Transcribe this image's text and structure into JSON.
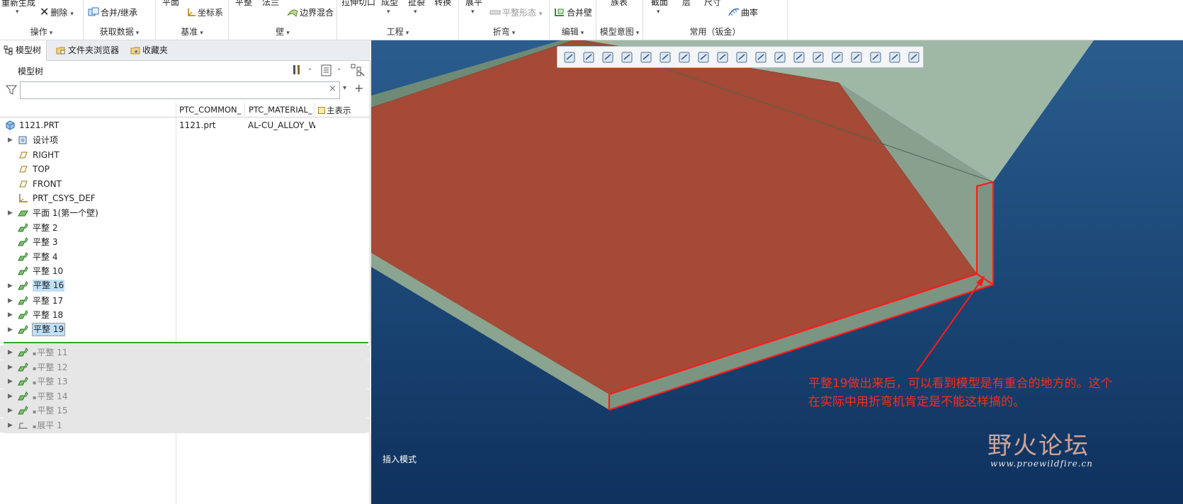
{
  "ribbon": {
    "top_row": {
      "regenerate": "重新生成",
      "delete": "删除",
      "merge_inherit": "合并/继承",
      "coord_sys": "坐标系",
      "plane": "平面",
      "flat": "平整",
      "flange": "法兰",
      "boundary_blend": "边界混合",
      "extrude_cut": "拉伸切口",
      "form": "成型",
      "rip": "扯裂",
      "convert": "转换",
      "unbend": "展平",
      "flat_state": "平整形态",
      "merge_wall": "合并壁",
      "family_table": "族表",
      "section": "截面",
      "layer": "层",
      "dimension": "尺寸",
      "curvature": "曲率"
    },
    "groups": {
      "operations": "操作",
      "get_data": "获取数据",
      "datum": "基准",
      "walls": "壁",
      "engineering": "工程",
      "bends": "折弯",
      "editing": "编辑",
      "model_intent": "模型意图",
      "common_sheetmetal": "常用（钣金）"
    }
  },
  "tabs": {
    "model_tree": "模型树",
    "folder_browser": "文件夹浏览器",
    "favorites": "收藏夹"
  },
  "tree": {
    "header": "模型树",
    "filter_placeholder": "",
    "columns": {
      "col1": "PTC_COMMON_",
      "col2": "PTC_MATERIAL_",
      "col3": "主表示"
    },
    "root": {
      "label": "1121.PRT",
      "c1": "1121.prt",
      "c2": "AL-CU_ALLOY_WR"
    },
    "items": [
      {
        "label": "设计项",
        "expandable": true,
        "icon": "design-items-icon"
      },
      {
        "label": "RIGHT",
        "expandable": false,
        "icon": "datum-plane-icon"
      },
      {
        "label": "TOP",
        "expandable": false,
        "icon": "datum-plane-icon"
      },
      {
        "label": "FRONT",
        "expandable": false,
        "icon": "datum-plane-icon"
      },
      {
        "label": "PRT_CSYS_DEF",
        "expandable": false,
        "icon": "csys-icon"
      },
      {
        "label": "平面 1(第一个壁)",
        "expandable": true,
        "icon": "first-wall-icon"
      },
      {
        "label": "平整 2",
        "expandable": false,
        "icon": "flat-wall-icon"
      },
      {
        "label": "平整 3",
        "expandable": false,
        "icon": "flat-wall-icon"
      },
      {
        "label": "平整 4",
        "expandable": false,
        "icon": "flat-wall-icon"
      },
      {
        "label": "平整 10",
        "expandable": false,
        "icon": "flat-wall-icon"
      },
      {
        "label": "平整 16",
        "expandable": true,
        "icon": "flat-wall-icon"
      },
      {
        "label": "平整 17",
        "expandable": true,
        "icon": "flat-wall-icon"
      },
      {
        "label": "平整 18",
        "expandable": true,
        "icon": "flat-wall-icon"
      },
      {
        "label": "平整 19",
        "expandable": true,
        "icon": "flat-wall-icon"
      }
    ],
    "suppressed": [
      {
        "label": "平整 11",
        "icon": "flat-wall-icon"
      },
      {
        "label": "平整 12",
        "icon": "flat-wall-icon"
      },
      {
        "label": "平整 13",
        "icon": "flat-wall-icon"
      },
      {
        "label": "平整 14",
        "icon": "flat-wall-icon"
      },
      {
        "label": "平整 15",
        "icon": "flat-wall-icon"
      },
      {
        "label": "展平 1",
        "icon": "unbend-icon"
      }
    ]
  },
  "viewport": {
    "mode": "插入模式",
    "annotation": "平整19做出来后，可以看到模型是有重合的地方的。这个在实际中用折弯机肯定是不能这样搞的。",
    "watermark_main": "野火论坛",
    "watermark_url": "www.proewildfire.cn",
    "colors": {
      "selected_face": "#a44a36",
      "sheet_face": "#8aa490",
      "sheet_edge": "#6f8a77",
      "highlight": "#ff1a1a"
    }
  }
}
